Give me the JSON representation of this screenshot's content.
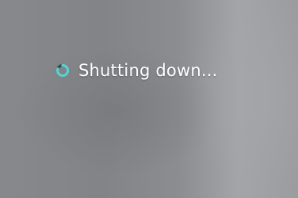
{
  "screen": {
    "status_text": "Shutting down...",
    "icon": "busy-spinner-icon",
    "colors": {
      "background": "#86888b",
      "text": "#ffffff",
      "spinner_accent": "#5fd0d0"
    }
  }
}
